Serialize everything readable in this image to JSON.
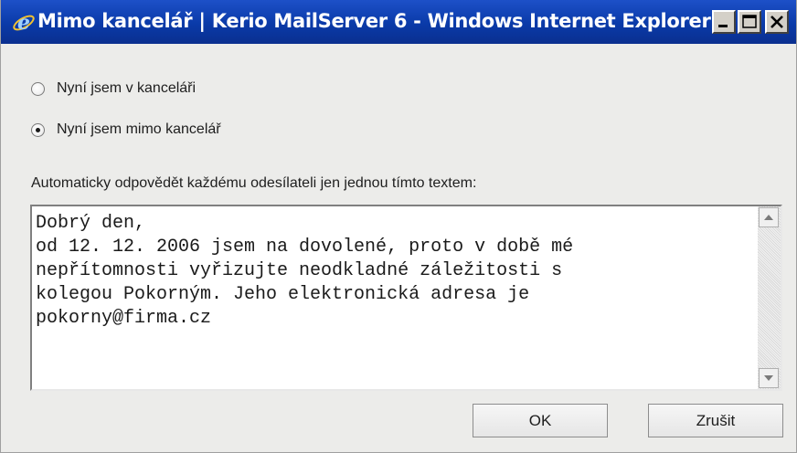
{
  "window": {
    "title": "Mimo kancelář | Kerio MailServer 6 - Windows Internet Explorer",
    "controls": [
      "minimize-icon",
      "maximize-icon",
      "close-icon"
    ]
  },
  "options": {
    "in_office_label": "Nyní jsem v kanceláři",
    "in_office_selected": false,
    "out_of_office_label": "Nyní jsem mimo kancelář",
    "out_of_office_selected": true
  },
  "auto_reply": {
    "label": "Automaticky odpovědět každému odesílateli jen jednou tímto textem:",
    "text": "Dobrý den,\nod 12. 12. 2006 jsem na dovolené, proto v době mé\nnepřítomnosti vyřizujte neodkladné záležitosti s\nkolegou Pokorným. Jeho elektronická adresa je\npokorny@firma.cz"
  },
  "buttons": {
    "ok_label": "OK",
    "cancel_label": "Zrušit"
  },
  "colors": {
    "titlebar": "#0a3aa8",
    "window_bg": "#ececea"
  }
}
